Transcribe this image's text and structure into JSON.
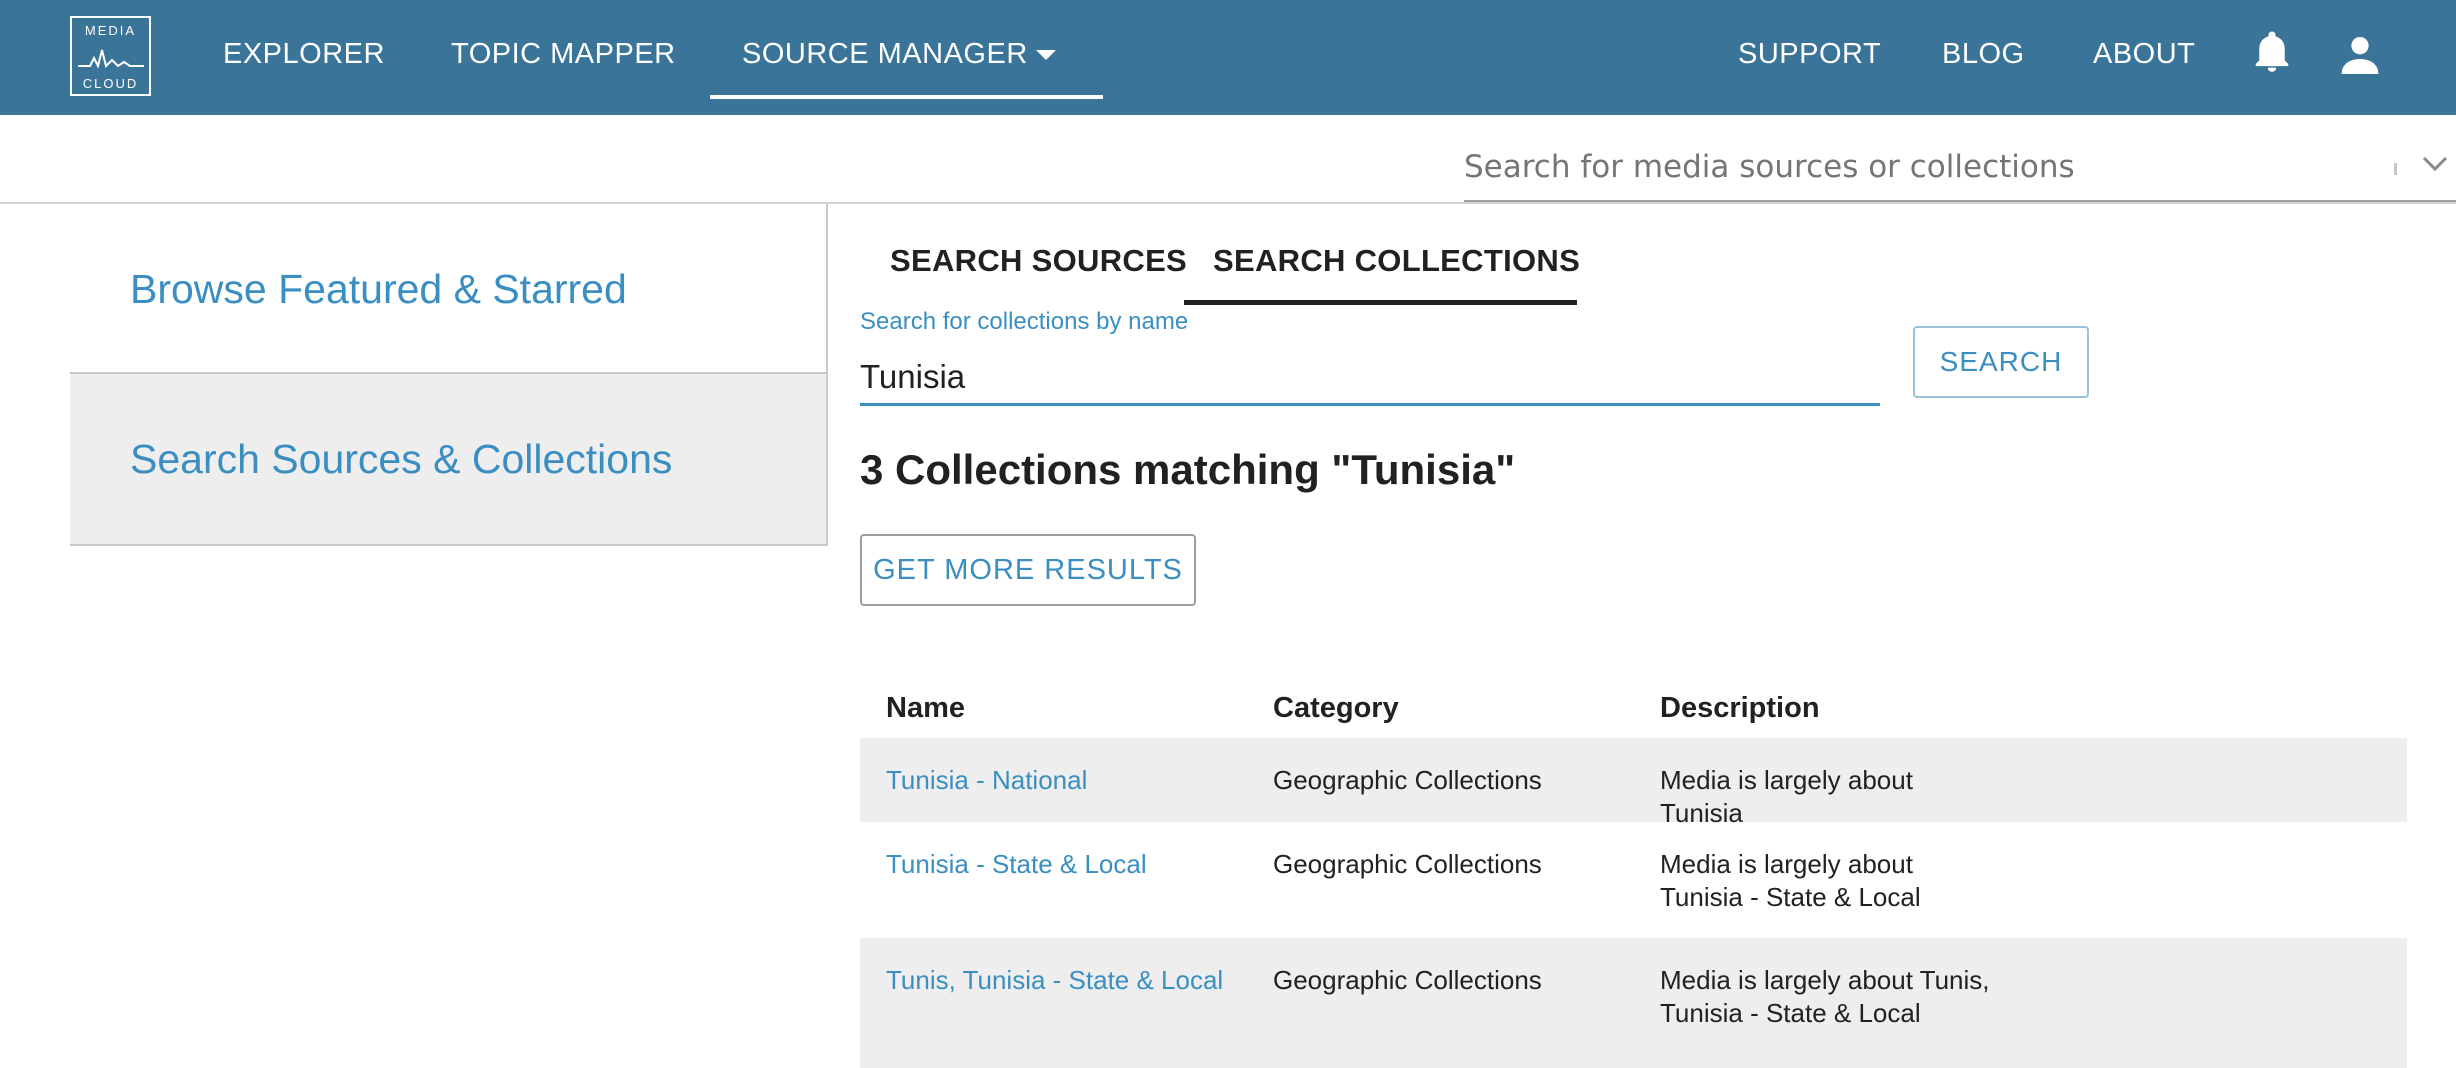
{
  "header": {
    "logo_top": "MEDIA",
    "logo_bottom": "CLOUD",
    "nav": [
      {
        "label": "EXPLORER"
      },
      {
        "label": "TOPIC MAPPER"
      },
      {
        "label": "SOURCE MANAGER"
      }
    ],
    "active_nav": "SOURCE MANAGER",
    "right_nav": [
      {
        "label": "SUPPORT"
      },
      {
        "label": "BLOG"
      },
      {
        "label": "ABOUT"
      }
    ],
    "icons": [
      "bell-icon",
      "account-icon"
    ],
    "bar_color": "#3a7499"
  },
  "global_search": {
    "placeholder": "Search for media sources or collections"
  },
  "sidebar": {
    "items": [
      {
        "label": "Browse Featured & Starred"
      },
      {
        "label": "Search Sources & Collections"
      }
    ],
    "selected": "Search Sources & Collections"
  },
  "tabs": {
    "items": [
      {
        "label": "SEARCH SOURCES"
      },
      {
        "label": "SEARCH COLLECTIONS"
      }
    ],
    "active": "SEARCH COLLECTIONS"
  },
  "collection_search": {
    "label": "Search for collections by name",
    "value": "Tunisia",
    "button_label": "SEARCH"
  },
  "results": {
    "heading": "3 Collections matching \"Tunisia\"",
    "more_button_label": "GET MORE RESULTS",
    "columns": [
      "Name",
      "Category",
      "Description"
    ],
    "rows": [
      {
        "name": "Tunisia - National",
        "category": "Geographic Collections",
        "description": "Media is largely about Tunisia"
      },
      {
        "name": "Tunisia - State & Local",
        "category": "Geographic Collections",
        "description": "Media is largely about Tunisia - State & Local"
      },
      {
        "name": "Tunis, Tunisia - State & Local",
        "category": "Geographic Collections",
        "description": "Media is largely about Tunis, Tunisia - State & Local"
      }
    ]
  },
  "colors": {
    "link": "#3a8ec1",
    "row_shade": "#eeeeee"
  }
}
